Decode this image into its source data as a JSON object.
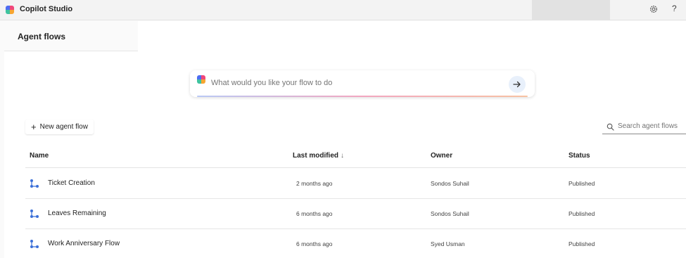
{
  "app": {
    "title": "Copilot Studio",
    "logo_icon": "copilot-logo-icon"
  },
  "topbar": {
    "settings_icon": "gear-icon",
    "help_label": "?"
  },
  "page": {
    "title": "Agent flows"
  },
  "prompt": {
    "placeholder": "What would you like your flow to do",
    "send_icon": "arrow-right-icon"
  },
  "toolbar": {
    "new_flow_label": "New agent flow",
    "search_placeholder": "Search agent flows"
  },
  "table": {
    "columns": {
      "name": "Name",
      "last_modified": "Last modified",
      "sort_indicator": "↓",
      "owner": "Owner",
      "status": "Status"
    },
    "rows": [
      {
        "name": "Ticket Creation",
        "last_modified": "2 months ago",
        "owner": "Sondos Suhail",
        "status": "Published"
      },
      {
        "name": "Leaves Remaining",
        "last_modified": "6 months ago",
        "owner": "Sondos Suhail",
        "status": "Published"
      },
      {
        "name": "Work Anniversary Flow",
        "last_modified": "6 months ago",
        "owner": "Syed Usman",
        "status": "Published"
      }
    ]
  },
  "colors": {
    "accent": "#3b6fd8",
    "flow_icon": "#3b6fd8"
  }
}
